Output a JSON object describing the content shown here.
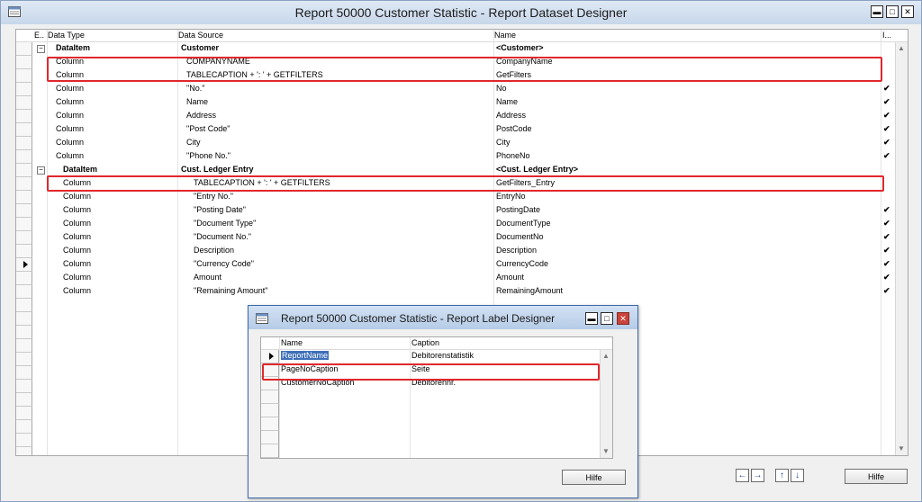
{
  "window": {
    "title": "Report 50000 Customer Statistic - Report Dataset Designer",
    "minimize": "▬",
    "maximize": "□",
    "close": "✕"
  },
  "grid": {
    "headers": [
      "E..",
      "Data Type",
      "Data Source",
      "Name",
      "I..."
    ],
    "rows": [
      {
        "type": "DataItem",
        "source": "Customer",
        "name": "<Customer>",
        "bold": true,
        "expand": "⊟",
        "check": ""
      },
      {
        "type": "Column",
        "source": "COMPANYNAME",
        "name": "CompanyName",
        "check": ""
      },
      {
        "type": "Column",
        "source": "TABLECAPTION + ': ' + GETFILTERS",
        "name": "GetFilters",
        "check": ""
      },
      {
        "type": "Column",
        "source": "\"No.\"",
        "name": "No",
        "check": "✔"
      },
      {
        "type": "Column",
        "source": "Name",
        "name": "Name",
        "check": "✔"
      },
      {
        "type": "Column",
        "source": "Address",
        "name": "Address",
        "check": "✔"
      },
      {
        "type": "Column",
        "source": "\"Post Code\"",
        "name": "PostCode",
        "check": "✔"
      },
      {
        "type": "Column",
        "source": "City",
        "name": "City",
        "check": "✔"
      },
      {
        "type": "Column",
        "source": "\"Phone No.\"",
        "name": "PhoneNo",
        "check": "✔"
      },
      {
        "type": "DataItem",
        "source": "Cust. Ledger Entry",
        "name": "<Cust. Ledger Entry>",
        "bold": true,
        "expand": "⊟",
        "check": ""
      },
      {
        "type": "Column",
        "source": "TABLECAPTION + ': ' + GETFILTERS",
        "name": "GetFilters_Entry",
        "check": ""
      },
      {
        "type": "Column",
        "source": "\"Entry No.\"",
        "name": "EntryNo",
        "check": ""
      },
      {
        "type": "Column",
        "source": "\"Posting Date\"",
        "name": "PostingDate",
        "check": "✔"
      },
      {
        "type": "Column",
        "source": "\"Document Type\"",
        "name": "DocumentType",
        "check": "✔"
      },
      {
        "type": "Column",
        "source": "\"Document No.\"",
        "name": "DocumentNo",
        "check": "✔"
      },
      {
        "type": "Column",
        "source": "Description",
        "name": "Description",
        "check": "✔"
      },
      {
        "type": "Column",
        "source": "\"Currency Code\"",
        "name": "CurrencyCode",
        "check": "✔"
      },
      {
        "type": "Column",
        "source": "Amount",
        "name": "Amount",
        "check": "✔"
      },
      {
        "type": "Column",
        "source": "\"Remaining Amount\"",
        "name": "RemainingAmount",
        "check": "✔"
      }
    ]
  },
  "nav_buttons": [
    "←",
    "→",
    "↑",
    "↓"
  ],
  "help_label": "Hilfe",
  "dialog": {
    "title": "Report 50000 Customer Statistic - Report Label Designer",
    "minimize": "▬",
    "maximize": "□",
    "close": "✕",
    "headers": [
      "Name",
      "Caption"
    ],
    "rows": [
      {
        "name": "ReportName",
        "caption": "Debitorenstatistik"
      },
      {
        "name": "PageNoCaption",
        "caption": "Seite"
      },
      {
        "name": "CustomerNoCaption",
        "caption": "Debitorennr."
      }
    ],
    "help_label": "Hilfe"
  },
  "colors": {
    "highlight": "#e0282c",
    "selection": "#3d6fb8"
  },
  "icons": [
    "window-app-icon",
    "dialog-app-icon",
    "scroll-up-icon",
    "scroll-down-icon",
    "row-pointer-icon",
    "checkmark-icon"
  ]
}
